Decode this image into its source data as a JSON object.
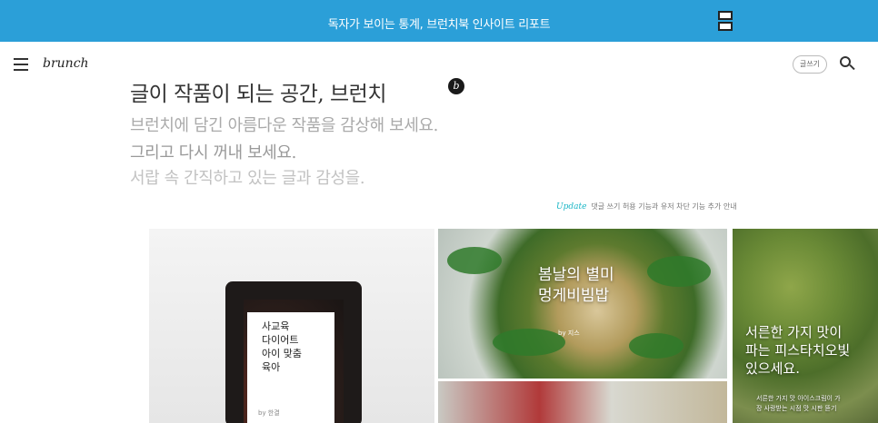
{
  "promo": {
    "text": "독자가 보이는 통계, 브런치북 인사이트 리포트"
  },
  "header": {
    "logo": "brunch",
    "write_label": "글쓰기"
  },
  "hero": {
    "title": "글이 작품이 되는 공간, 브런치",
    "lines": [
      "브런치에 담긴 아름다운 작품을 감상해 보세요.",
      "그리고 다시 꺼내 보세요.",
      "서랍 속 간직하고 있는 글과 감성을."
    ]
  },
  "update": {
    "tag": "Update",
    "text": "댓글 쓰기 허용 기능과 유저 차단 기능 추가 안내"
  },
  "cards": [
    {
      "title": "사교육\n다이어트\n아이 맞춤\n육아",
      "author": "by 한결"
    },
    {
      "title": "봄날의 별미\n멍게비빔밥",
      "author": "by 지스"
    },
    {
      "title": ""
    },
    {
      "title": "서른한 가지 맛이\n파는 피스타치오빛\n있으세요.",
      "subtitle": "서른한 가지 맛 아이스크림이 가\n장 사랑받는 시점 맛 시판 뜯기"
    }
  ]
}
